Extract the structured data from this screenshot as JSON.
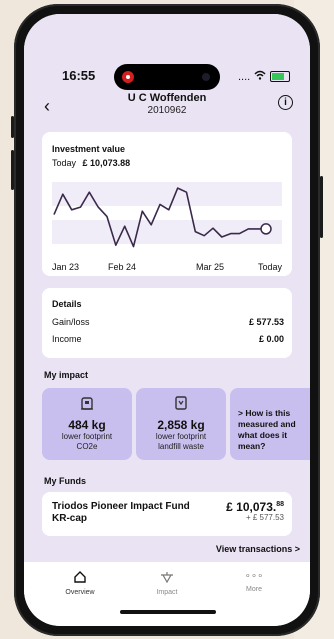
{
  "status": {
    "time": "16:55",
    "signal": "....",
    "wifi": "◉"
  },
  "header": {
    "title": "U C Woffenden",
    "subtitle": "2010962"
  },
  "investment": {
    "label": "Investment value",
    "today_label": "Today",
    "today_value": "£ 10,073.88",
    "x_ticks": [
      "Jan 23",
      "Feb 24",
      "Mar 25",
      "Today"
    ]
  },
  "chart_data": {
    "type": "line",
    "x": [
      "Jan 23",
      "Feb 24",
      "Mar 25",
      "Today"
    ],
    "y": [
      0.55,
      0.85,
      0.62,
      0.66,
      0.88,
      0.66,
      0.52,
      0.1,
      0.38,
      0.08,
      0.6,
      0.4,
      0.7,
      0.62,
      0.94,
      0.88,
      0.3,
      0.24,
      0.35,
      0.22,
      0.27,
      0.27,
      0.34,
      0.34,
      0.34
    ],
    "ylim": [
      0,
      1
    ],
    "grid": true
  },
  "details": {
    "title": "Details",
    "gain_label": "Gain/loss",
    "gain_value": "£ 577.53",
    "income_label": "Income",
    "income_value": "£ 0.00"
  },
  "impact": {
    "title": "My impact",
    "tiles": [
      {
        "icon": "building-icon",
        "value": "484 kg",
        "line1": "lower footprint",
        "line2": "CO2e"
      },
      {
        "icon": "bin-icon",
        "value": "2,858 kg",
        "line1": "lower footprint",
        "line2": "landfill waste"
      }
    ],
    "more_text": "> How is this measured and what does it mean?"
  },
  "funds": {
    "title": "My Funds",
    "name_line1": "Triodos Pioneer Impact Fund",
    "name_line2": "KR-cap",
    "value_main": "£ 10,073.",
    "value_pence": "88",
    "change": "+ £ 577.53",
    "view_link": "View transactions >"
  },
  "tabs": [
    {
      "label": "Overview",
      "icon": "home-icon"
    },
    {
      "label": "Impact",
      "icon": "impact-icon"
    },
    {
      "label": "More",
      "icon": "more-icon"
    }
  ],
  "colors": {
    "background": "#e9e3f3",
    "accent": "#c9bfee",
    "line": "#3a2a4a"
  }
}
